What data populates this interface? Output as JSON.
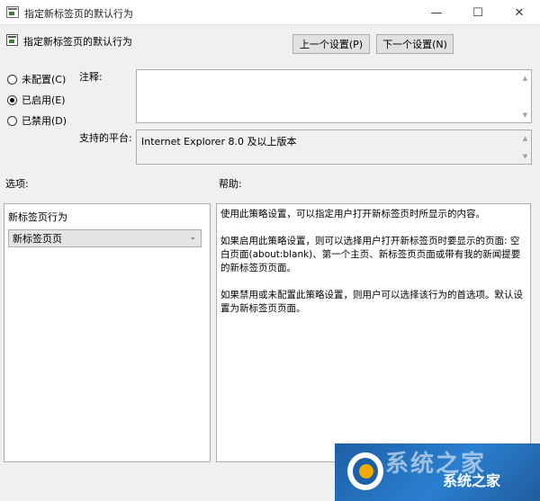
{
  "window": {
    "title": "指定新标签页的默认行为",
    "minimize": "—",
    "maximize": "☐",
    "close": "✕"
  },
  "header": {
    "title": "指定新标签页的默认行为",
    "prev_button": "上一个设置(P)",
    "next_button": "下一个设置(N)"
  },
  "state": {
    "options": [
      {
        "label": "未配置(C)",
        "checked": false
      },
      {
        "label": "已启用(E)",
        "checked": true
      },
      {
        "label": "已禁用(D)",
        "checked": false
      }
    ]
  },
  "comment": {
    "label": "注释:",
    "value": ""
  },
  "platform": {
    "label": "支持的平台:",
    "value": "Internet Explorer 8.0 及以上版本"
  },
  "options_section": {
    "label": "选项:",
    "field_label": "新标签页行为",
    "selected": "新标签页页"
  },
  "help": {
    "label": "帮助:",
    "paragraphs": [
      "使用此策略设置，可以指定用户打开新标签页时所显示的内容。",
      "如果启用此策略设置，则可以选择用户打开新标签页时要显示的页面: 空白页面(about:blank)、第一个主页、新标签页页面或带有我的新闻提要的新标签页页面。",
      "如果禁用或未配置此策略设置，则用户可以选择该行为的首选项。默认设置为新标签页页面。"
    ]
  },
  "watermark": {
    "text": "系统之家"
  }
}
